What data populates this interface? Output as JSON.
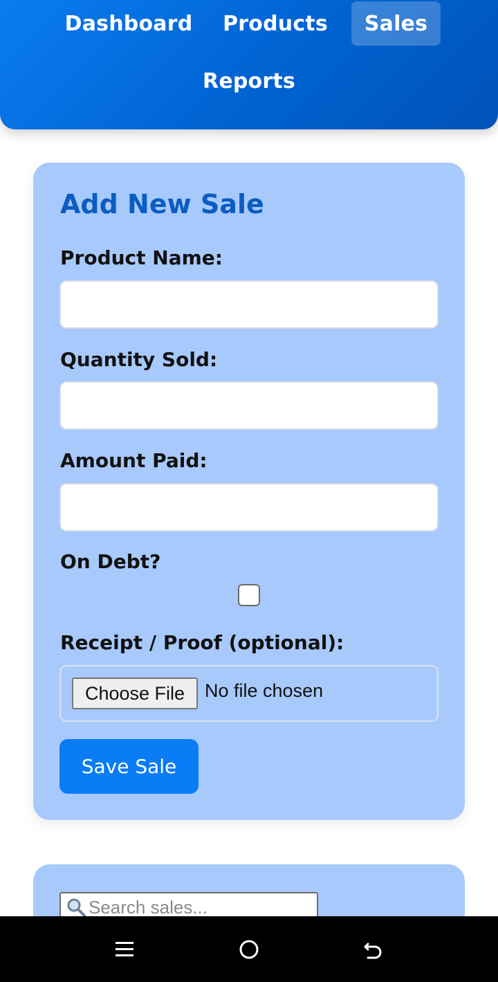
{
  "nav": {
    "items": [
      {
        "label": "Dashboard"
      },
      {
        "label": "Products"
      },
      {
        "label": "Sales",
        "active": true
      },
      {
        "label": "Reports"
      }
    ]
  },
  "form": {
    "title": "Add New Sale",
    "product_label": "Product Name:",
    "product_value": "",
    "quantity_label": "Quantity Sold:",
    "quantity_value": "",
    "amount_label": "Amount Paid:",
    "amount_value": "",
    "debt_label": "On Debt?",
    "debt_checked": false,
    "receipt_label": "Receipt / Proof (optional):",
    "file_button_label": "Choose File",
    "file_status": "No file chosen",
    "save_label": "Save Sale"
  },
  "search": {
    "placeholder": "Search sales...",
    "value": ""
  },
  "system_nav": {
    "icons": [
      "menu-icon",
      "home-icon",
      "back-icon"
    ]
  },
  "colors": {
    "header": "#0063d1",
    "card": "#a8c9fb",
    "title": "#0a5dc2",
    "button": "#0a7cf5"
  }
}
